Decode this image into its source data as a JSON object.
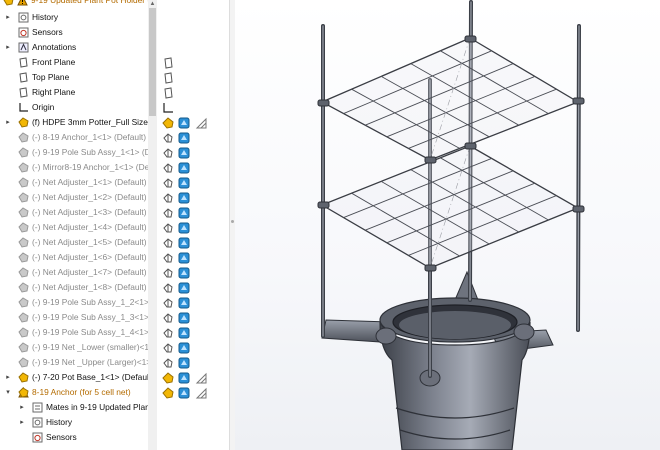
{
  "tree": {
    "root": {
      "label": "9-19 Updated Plant Pot Holder ("
    },
    "items": [
      {
        "label": "History",
        "icon": "history-icon"
      },
      {
        "label": "Sensors",
        "icon": "sensors-icon"
      },
      {
        "label": "Annotations",
        "icon": "annotations-icon"
      },
      {
        "label": "Front Plane",
        "icon": "plane-icon"
      },
      {
        "label": "Top Plane",
        "icon": "plane-icon"
      },
      {
        "label": "Right Plane",
        "icon": "plane-icon"
      },
      {
        "label": "Origin",
        "icon": "origin-icon"
      },
      {
        "label": "(f) HDPE 3mm Potter_Full Size<",
        "icon": "part-icon"
      },
      {
        "label": "(-) 8-19 Anchor_1<1> (Default)",
        "icon": "part-icon"
      },
      {
        "label": "(-) 9-19 Pole Sub Assy_1<1> (De",
        "icon": "assembly-icon"
      },
      {
        "label": "(-) Mirror8-19 Anchor_1<1> (De",
        "icon": "part-icon"
      },
      {
        "label": "(-) Net Adjuster_1<1> (Default)",
        "icon": "part-icon"
      },
      {
        "label": "(-) Net Adjuster_1<2> (Default)",
        "icon": "part-icon"
      },
      {
        "label": "(-) Net Adjuster_1<3> (Default)",
        "icon": "part-icon"
      },
      {
        "label": "(-) Net Adjuster_1<4> (Default)",
        "icon": "part-icon"
      },
      {
        "label": "(-) Net Adjuster_1<5> (Default)",
        "icon": "part-icon"
      },
      {
        "label": "(-) Net Adjuster_1<6> (Default)",
        "icon": "part-icon"
      },
      {
        "label": "(-) Net Adjuster_1<7> (Default)",
        "icon": "part-icon"
      },
      {
        "label": "(-) Net Adjuster_1<8> (Default)",
        "icon": "part-icon"
      },
      {
        "label": "(-) 9-19 Pole Sub Assy_1_2<1> (",
        "icon": "assembly-icon"
      },
      {
        "label": "(-) 9-19 Pole Sub Assy_1_3<1> (",
        "icon": "assembly-icon"
      },
      {
        "label": "(-) 9-19 Pole Sub Assy_1_4<1> (",
        "icon": "assembly-icon"
      },
      {
        "label": "(-) 9-19 Net _Lower (smaller)<1:",
        "icon": "part-icon"
      },
      {
        "label": "(-) 9-19 Net _Upper (Larger)<1>",
        "icon": "part-icon"
      },
      {
        "label": "(-) 7-20 Pot Base_1<1> (Default",
        "icon": "part-icon"
      },
      {
        "label": "8-19 Anchor (for 5 cell net)",
        "icon": "part-icon"
      },
      {
        "label": "Mates in 9-19 Updated Plan",
        "icon": "mates-icon"
      },
      {
        "label": "History",
        "icon": "history-icon"
      },
      {
        "label": "Sensors",
        "icon": "sensors-icon"
      }
    ]
  },
  "colors": {
    "part_yellow": "#f2b705",
    "assy_blue": "#2b8fd6",
    "warning": "#e6a100",
    "faded": "#8a8a8a",
    "model": "#6b6f7a"
  }
}
